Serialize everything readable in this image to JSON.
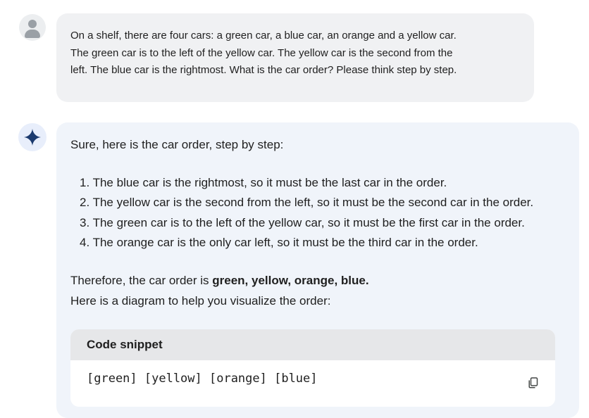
{
  "user_message": {
    "lines": [
      "On a shelf, there are four cars: a green car, a blue car, an orange and a yellow car.",
      "The green car is to the left of the yellow car. The yellow car is the second from the",
      "left. The blue car is the rightmost. What is the car order? Please think step by step."
    ]
  },
  "assistant_message": {
    "intro": "Sure, here is the car order, step by step:",
    "steps": [
      "1. The blue car is the rightmost, so it must be the last car in the order.",
      "2. The yellow car is the second from the left, so it must be the second car in the order.",
      "3. The green car is to the left of the yellow car, so it must be the first car in the order.",
      "4. The orange car is the only car left, so it must be the third car in the order."
    ],
    "conclusion_prefix": "Therefore, the car order is ",
    "conclusion_bold": "green, yellow, orange, blue.",
    "diagram_intro": "Here is a diagram to help you visualize the order:",
    "code_block": {
      "header": "Code snippet",
      "code": "[green] [yellow] [orange] [blue]"
    }
  },
  "icons": {
    "user_avatar": "person-icon",
    "assistant_avatar": "sparkle-icon",
    "copy": "copy-icon"
  },
  "colors": {
    "user_bubble": "#f0f1f3",
    "assistant_bubble": "#f0f4fa",
    "sparkle": "#1b3a6e"
  }
}
